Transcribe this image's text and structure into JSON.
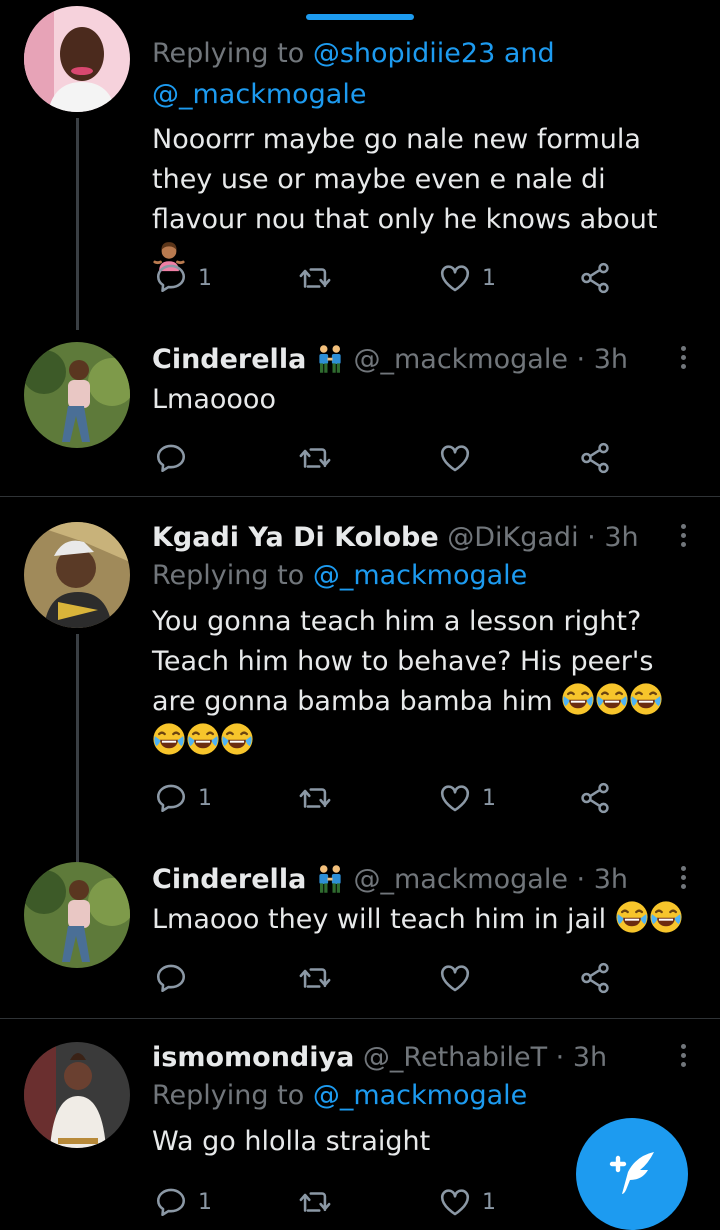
{
  "colors": {
    "background": "#000000",
    "accent": "#1d9bf0",
    "muted": "#71767b",
    "text": "#e7e9ea"
  },
  "tweets": [
    {
      "replying_prefix": "Replying to",
      "replying_to": "@shopidiie23 and",
      "replying_to2": "@_mackmogale",
      "text": "Nooorrr maybe go nale new formula they use or maybe even e nale di flavour nou that only he knows about",
      "emoji": "person-shrugging",
      "replies": "1",
      "likes": "1"
    },
    {
      "name": "Cinderella",
      "handle": "@_mackmogale",
      "sep": "·",
      "time": "3h",
      "name_emoji": "two-men-holding-hands",
      "text": "Lmaoooo"
    },
    {
      "name": "Kgadi Ya Di Kolobe",
      "handle": "@DiKgadi",
      "sep": "·",
      "time": "3h",
      "replying_prefix": "Replying to",
      "replying_to": "@_mackmogale",
      "text": "You gonna teach him a lesson right? Teach him how to behave? His peer's are gonna bamba bamba him",
      "emoji": "face-with-tears-of-joy x6",
      "replies": "1",
      "likes": "1"
    },
    {
      "name": "Cinderella",
      "handle": "@_mackmogale",
      "sep": "·",
      "time": "3h",
      "name_emoji": "two-men-holding-hands",
      "text": "Lmaooo they will teach him in jail",
      "emoji": "face-with-tears-of-joy x2"
    },
    {
      "name": "ismomondiya",
      "handle": "@_RethabileT",
      "sep": "·",
      "time": "3h",
      "replying_prefix": "Replying to",
      "replying_to": "@_mackmogale",
      "text": "Wa go hlolla straight",
      "replies": "1",
      "likes": "1"
    }
  ],
  "fab": {
    "icon": "compose-tweet-icon"
  }
}
